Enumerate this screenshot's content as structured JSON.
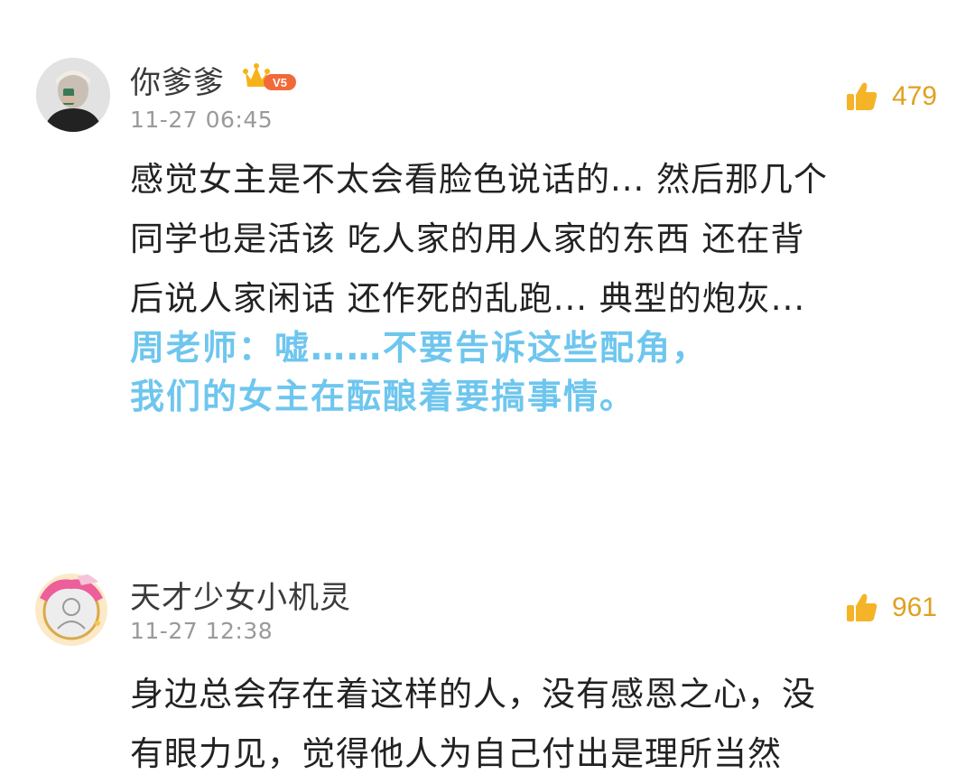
{
  "comments": [
    {
      "username": "你爹爹",
      "vip_level": "V5",
      "time": "11-27 06:45",
      "likes": "479",
      "text_lines": [
        "感觉女主是不太会看脸色说话的... 然后那几个",
        "同学也是活该 吃人家的用人家的东西 还在背",
        "后说人家闲话 还作死的乱跑... 典型的炮灰..."
      ],
      "annotation_lines": [
        "周老师：嘘……不要告诉这些配角，",
        "我们的女主在酝酿着要搞事情。"
      ]
    },
    {
      "username": "天才少女小机灵",
      "time": "11-27 12:38",
      "likes": "961",
      "text_lines": [
        "身边总会存在着这样的人，没有感恩之心，没",
        "有眼力见，觉得他人为自己付出是理所当然"
      ]
    }
  ],
  "colors": {
    "username": "#3a3a3a",
    "time": "#9a9a9a",
    "like": "#e0a020",
    "annotation": "#6ec6ee",
    "body": "#222222"
  },
  "icons": {
    "like": "thumbs-up-icon",
    "vip": "crown-vip-icon"
  }
}
